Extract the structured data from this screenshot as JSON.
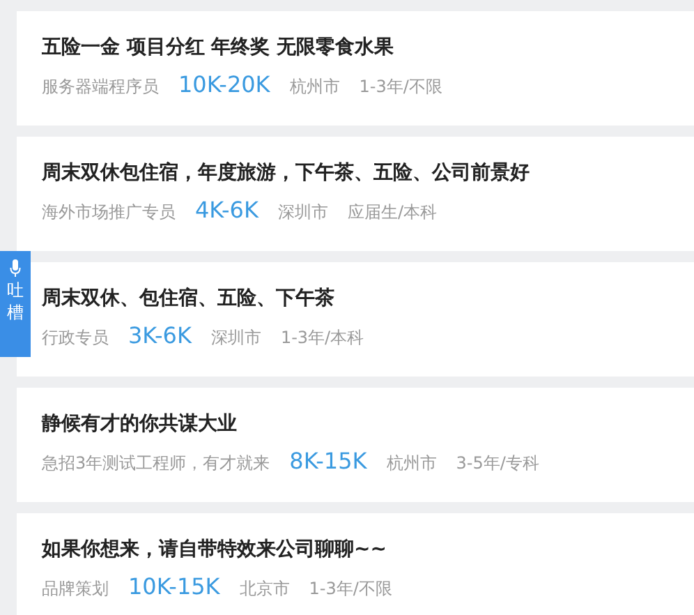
{
  "jobs": [
    {
      "title": "五险一金 项目分红 年终奖 无限零食水果",
      "position": "服务器端程序员",
      "salary": "10K-20K",
      "city": "杭州市",
      "requirement": "1-3年/不限"
    },
    {
      "title": "周末双休包住宿，年度旅游，下午茶、五险、公司前景好",
      "position": "海外市场推广专员",
      "salary": "4K-6K",
      "city": "深圳市",
      "requirement": "应届生/本科"
    },
    {
      "title": "周末双休、包住宿、五险、下午茶",
      "position": "行政专员",
      "salary": "3K-6K",
      "city": "深圳市",
      "requirement": "1-3年/本科"
    },
    {
      "title": "静候有才的你共谋大业",
      "position": "急招3年测试工程师，有才就来",
      "salary": "8K-15K",
      "city": "杭州市",
      "requirement": "3-5年/专科"
    },
    {
      "title": "如果你想来，请自带特效来公司聊聊~~",
      "position": "品牌策划",
      "salary": "10K-15K",
      "city": "北京市",
      "requirement": "1-3年/不限"
    }
  ],
  "feedback_tab": {
    "label": "吐槽"
  }
}
